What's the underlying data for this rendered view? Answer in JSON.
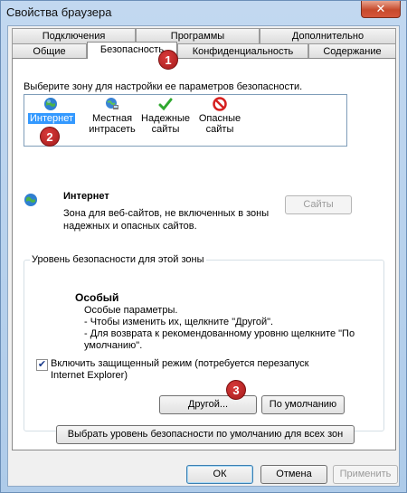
{
  "window": {
    "title": "Свойства браузера",
    "close_glyph": "✕"
  },
  "tabs_row1": [
    "Подключения",
    "Программы",
    "Дополнительно"
  ],
  "tabs_row2": [
    "Общие",
    "Безопасность",
    "Конфиденциальность",
    "Содержание"
  ],
  "security": {
    "zone_prompt": "Выберите зону для настройки ее параметров безопасности.",
    "zones": [
      {
        "label": "Интернет",
        "icon": "globe-icon",
        "selected": true
      },
      {
        "label": "Местная интрасеть",
        "icon": "intranet-icon",
        "selected": false
      },
      {
        "label": "Надежные сайты",
        "icon": "checkmark-icon",
        "selected": false
      },
      {
        "label": "Опасные сайты",
        "icon": "restricted-icon",
        "selected": false
      }
    ],
    "zone_title": "Интернет",
    "zone_desc": "Зона для веб-сайтов, не включенных в зоны надежных и опасных сайтов.",
    "sites_button": "Сайты",
    "level_legend": "Уровень безопасности для этой зоны",
    "level_title": "Особый",
    "level_lines": [
      "Особые параметры.",
      "- Чтобы изменить их, щелкните \"Другой\".",
      "- Для возврата к рекомендованному уровню щелкните \"По умолчанию\"."
    ],
    "protected_mode": {
      "checked": true,
      "label": "Включить защищенный режим (потребуется перезапуск Internet Explorer)"
    },
    "other_button": "Другой...",
    "default_button": "По умолчанию",
    "reset_all_button": "Выбрать уровень безопасности по умолчанию для всех зон"
  },
  "annotations": [
    "1",
    "2",
    "3"
  ],
  "footer": {
    "ok": "ОК",
    "cancel": "Отмена",
    "apply": "Применить"
  },
  "colors": {
    "selection": "#3399ff",
    "badge": "#b52222",
    "accent_green": "#2fa82f"
  }
}
